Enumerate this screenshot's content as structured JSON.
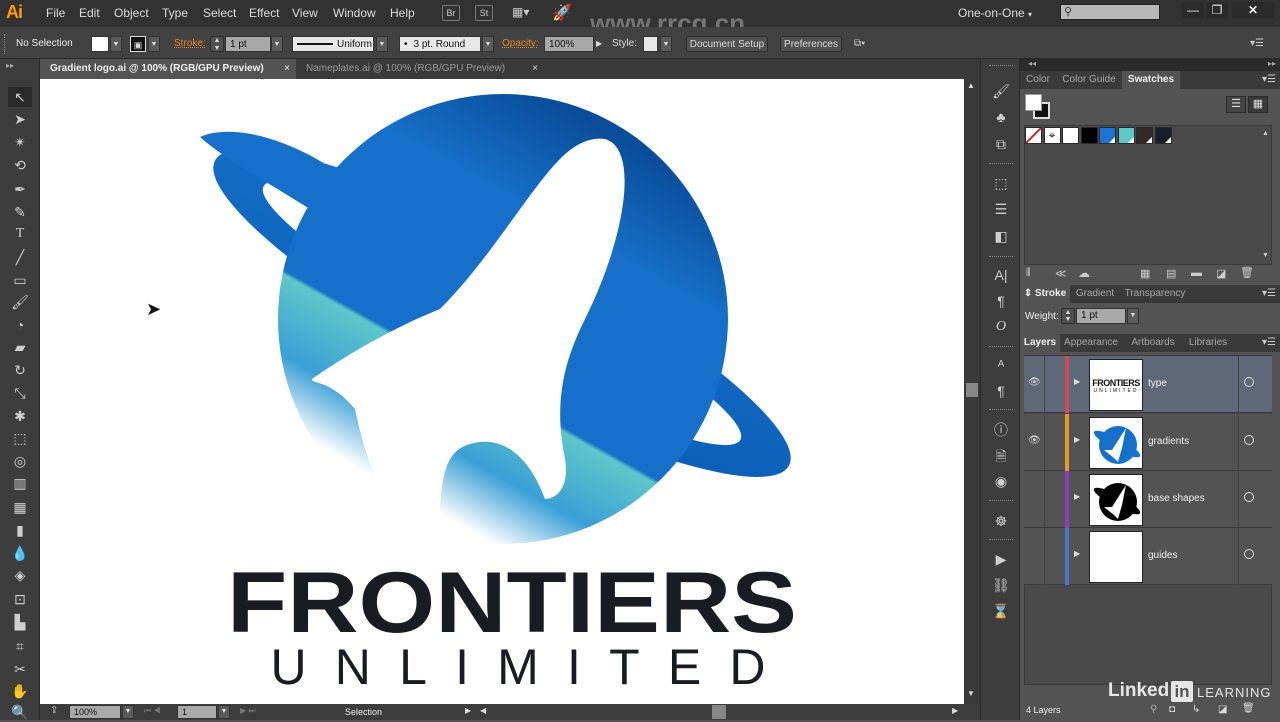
{
  "app": {
    "logo": "Ai",
    "watermark_url": "www.rrcg.cn"
  },
  "menu": [
    "File",
    "Edit",
    "Object",
    "Type",
    "Select",
    "Effect",
    "View",
    "Window",
    "Help"
  ],
  "menubar_buttons": {
    "bridge": "Br",
    "stock": "St"
  },
  "workspace": "One-on-One",
  "window_controls": {
    "minimize": "—",
    "restore": "❐",
    "close": "✕"
  },
  "control_bar": {
    "selection_status": "No Selection",
    "stroke_label": "Stroke:",
    "stroke_weight": "1 pt",
    "stroke_profile": "Uniform",
    "brush": "3 pt. Round",
    "opacity_label": "Opacity:",
    "opacity": "100%",
    "style_label": "Style:",
    "document_setup": "Document Setup",
    "preferences": "Preferences"
  },
  "tabs": [
    {
      "label": "Gradient logo.ai @ 100% (RGB/GPU Preview)",
      "active": true
    },
    {
      "label": "Nameplates.ai @ 100% (RGB/GPU Preview)",
      "active": false
    }
  ],
  "artwork": {
    "title": "FRONTIERS",
    "subtitle": "UNLIMITED",
    "colors": {
      "deep_blue": "#0a5db5",
      "mid_blue": "#1670c9",
      "teal": "#5fc6c9",
      "text": "#1a1c24"
    }
  },
  "status_bar": {
    "zoom": "100%",
    "artboard": "1",
    "tool": "Selection"
  },
  "swatches_panel": {
    "tabs": [
      "Color",
      "Color Guide",
      "Swatches"
    ],
    "active_tab": "Swatches",
    "swatches": [
      {
        "name": "None",
        "color": "#ffffff"
      },
      {
        "name": "Registration",
        "color": "#ffffff"
      },
      {
        "name": "White",
        "color": "#ffffff"
      },
      {
        "name": "Black",
        "color": "#000000"
      },
      {
        "name": "Blue",
        "color": "#1b74d4"
      },
      {
        "name": "Teal",
        "color": "#5fc6c9"
      },
      {
        "name": "Dark Brown",
        "color": "#332a27"
      },
      {
        "name": "Dark Navy",
        "color": "#191f28"
      }
    ]
  },
  "stroke_panel": {
    "tabs": [
      "Stroke",
      "Gradient",
      "Transparency"
    ],
    "active_tab": "Stroke",
    "weight_label": "Weight:",
    "weight": "1 pt"
  },
  "layers_panel": {
    "tabs": [
      "Layers",
      "Appearance",
      "Artboards",
      "Libraries"
    ],
    "active_tab": "Layers",
    "layers": [
      {
        "name": "type",
        "color": "#d0495c",
        "visible": true,
        "selected": true
      },
      {
        "name": "gradients",
        "color": "#e9962a",
        "visible": true,
        "selected": false
      },
      {
        "name": "base shapes",
        "color": "#8a3fc7",
        "visible": false,
        "selected": false
      },
      {
        "name": "guides",
        "color": "#4f74d0",
        "visible": false,
        "selected": false
      }
    ],
    "count": "4 Layers"
  },
  "branding": {
    "linked": "Linked",
    "in": "in",
    "learning": "LEARNING"
  }
}
